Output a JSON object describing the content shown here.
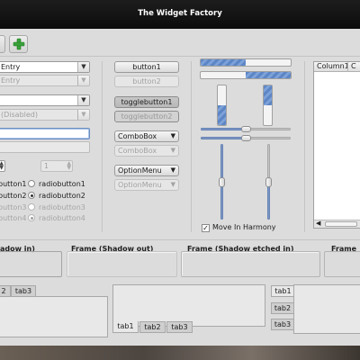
{
  "window": {
    "title": "The Widget Factory"
  },
  "toolbar": {
    "add_icon_color": "#3aa13a"
  },
  "entries": {
    "entry1": "Entry",
    "entry2": "Entry",
    "entry5": "(Disabled)",
    "entry6": ""
  },
  "spin": {
    "enabled_value": "",
    "disabled_value": "1"
  },
  "radios": {
    "col1": [
      "button1",
      "button2",
      "button3",
      "button4"
    ],
    "col2": [
      "radiobutton1",
      "radiobutton2",
      "radiobutton3",
      "radiobutton4"
    ],
    "selected_index": 1
  },
  "buttons": {
    "button1": "button1",
    "button2": "button2",
    "toggle1": "togglebutton1",
    "toggle2": "togglebutton2",
    "combo1": "ComboBox",
    "combo2": "ComboBox",
    "option1": "OptionMenu",
    "option2": "OptionMenu"
  },
  "progress": {
    "h1": 0.5,
    "h2": 0.5,
    "v1": 0.5,
    "v2": 0.5
  },
  "scales": {
    "h1": 0.5,
    "h2": 0.5,
    "v1": 0.5,
    "v2": 0.5
  },
  "checkbox": {
    "label": "Move In Harmony",
    "checked": true,
    "mark": "✓"
  },
  "tree": {
    "columns": [
      "Column1",
      "C"
    ]
  },
  "frames": {
    "f1": "adow in)",
    "f2": "Frame (Shadow out)",
    "f3": "Frame (Shadow etched in)",
    "f4": "Frame"
  },
  "notebooks": {
    "nb1_tabs": [
      "2",
      "tab3"
    ],
    "nb2_tabs": [
      "tab1",
      "tab2",
      "tab3"
    ],
    "nb3_tabs": [
      "tab1",
      "tab2",
      "tab3"
    ]
  },
  "colors": {
    "accent": "#6a8ec2",
    "window_bg": "#dcdcdc",
    "title_bg": "#111111"
  }
}
